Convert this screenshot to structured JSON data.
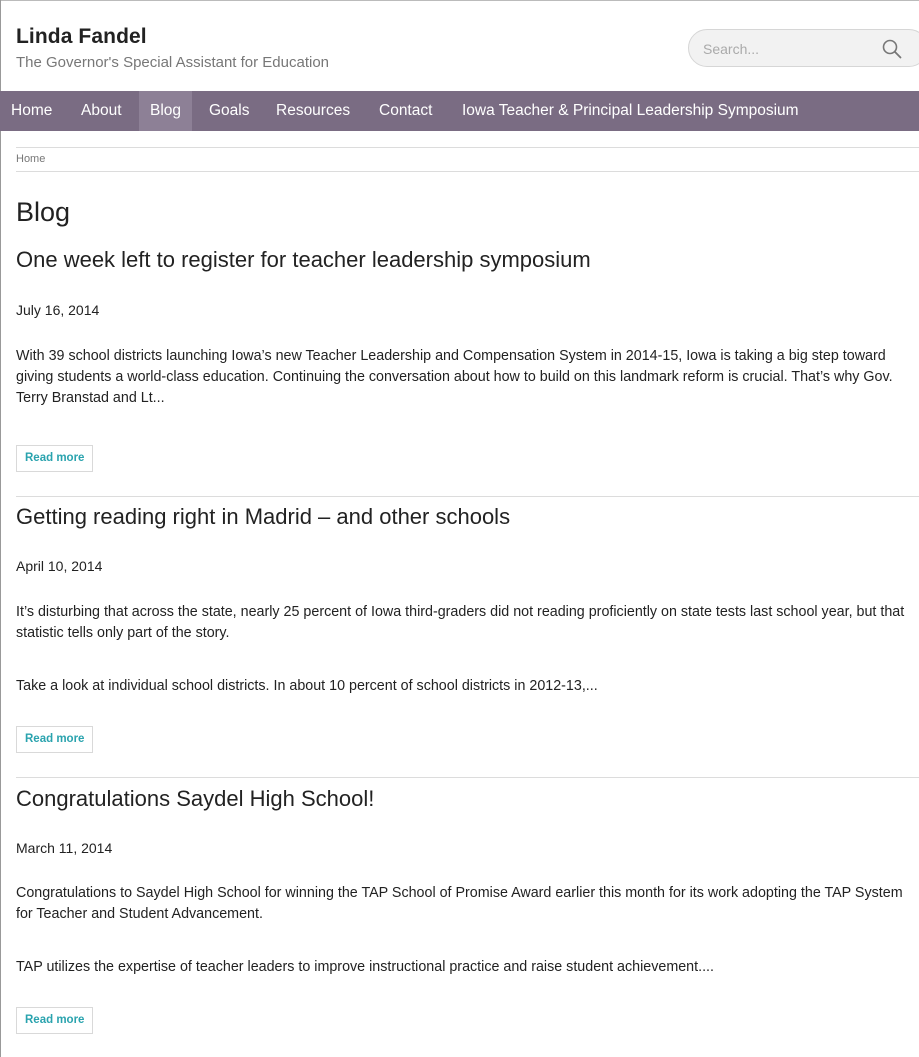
{
  "site": {
    "title": "Linda Fandel",
    "slogan": "The Governor's Special Assistant for Education"
  },
  "search": {
    "placeholder": "Search...",
    "icon": "magnifier-icon"
  },
  "nav": {
    "items": [
      {
        "label": "Home",
        "active": false
      },
      {
        "label": "About",
        "active": false
      },
      {
        "label": "Blog",
        "active": true
      },
      {
        "label": "Goals",
        "active": false
      },
      {
        "label": "Resources",
        "active": false
      },
      {
        "label": "Contact",
        "active": false
      },
      {
        "label": "Iowa Teacher & Principal Leadership Symposium",
        "active": false
      }
    ],
    "background": "#7a6c83",
    "active_background": "#8d8096"
  },
  "breadcrumb": {
    "home": "Home"
  },
  "page": {
    "title": "Blog"
  },
  "posts": [
    {
      "title": "One week left to register for teacher leadership symposium",
      "date": "July 16, 2014",
      "paragraphs": [
        "With 39 school districts launching Iowa’s new Teacher Leadership and Compensation System in 2014-15, Iowa is taking a big step toward giving students a world-class education. Continuing the conversation about how to build on this landmark reform is crucial. That’s why Gov. Terry Branstad and Lt..."
      ],
      "read_more": "Read more"
    },
    {
      "title": "Getting reading right in Madrid – and other schools",
      "date": "April 10, 2014",
      "paragraphs": [
        "It’s disturbing that across the state, nearly 25 percent of Iowa third-graders did not reading proficiently on state tests last school year, but that statistic tells only part of the story.",
        "Take a look at individual school districts. In about 10 percent of school districts in 2012-13,..."
      ],
      "read_more": "Read more"
    },
    {
      "title": "Congratulations Saydel High School!",
      "date": "March 11, 2014",
      "paragraphs": [
        "Congratulations to Saydel High School for winning the TAP School of Promise Award earlier this month for its work adopting the TAP System for Teacher and Student Advancement.",
        "TAP utilizes the expertise of teacher leaders to improve instructional practice and raise student achievement...."
      ],
      "read_more": "Read more"
    }
  ],
  "colors": {
    "link_accent": "#2aa3ae",
    "text": "#222222",
    "slogan": "#777777"
  }
}
